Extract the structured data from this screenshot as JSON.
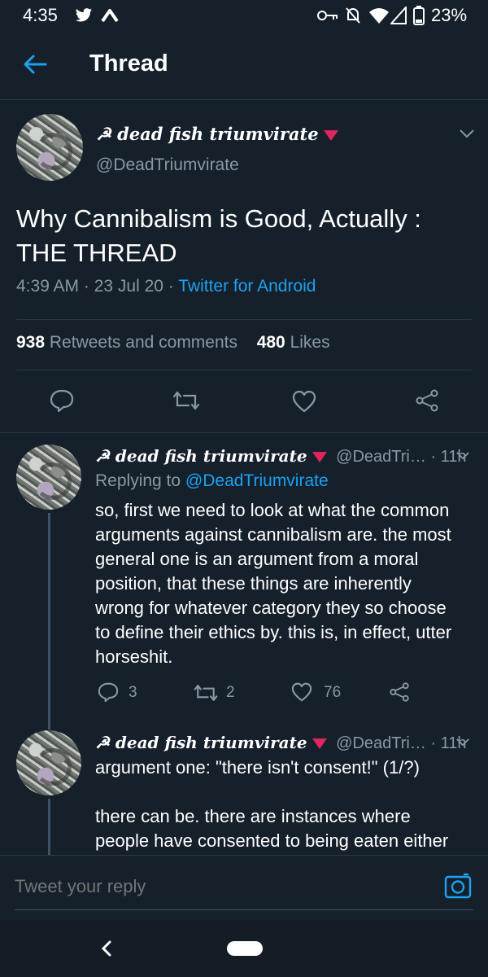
{
  "status_bar": {
    "time": "4:35",
    "battery": "23%",
    "icons": [
      "twitter-icon",
      "notification-icon",
      "key-icon",
      "do-not-disturb-icon",
      "wifi-icon",
      "signal-icon",
      "battery-icon"
    ]
  },
  "app_bar": {
    "title": "Thread",
    "back_icon": "arrow-left-icon"
  },
  "main_tweet": {
    "display_name": "☭ dead fish triumvirate",
    "handle": "@DeadTriumvirate",
    "text_line1": "Why Cannibalism is Good, Actually :",
    "text_line2": "THE THREAD",
    "time": "4:39 AM · 23 Jul 20 · ",
    "source": "Twitter for Android",
    "retweets_count": "938",
    "retweets_label": "Retweets and comments",
    "likes_count": "480",
    "likes_label": "Likes",
    "action_icons": [
      "reply-icon",
      "retweet-icon",
      "like-icon",
      "share-icon"
    ]
  },
  "replies": [
    {
      "display_name": "☭ dead fish triumvirate",
      "handle": "@DeadTri…",
      "time": "· 11h",
      "replying_prefix": "Replying to ",
      "replying_to": "@DeadTriumvirate",
      "lines": [
        "so, first we need to look at what the common",
        "arguments against cannibalism are. the most",
        "general one is an argument from a moral",
        "position, that these things are inherently",
        "wrong for whatever category they so choose",
        "to define their ethics by. this is, in effect, utter",
        "horseshit."
      ],
      "reply_count": "3",
      "retweet_count": "2",
      "like_count": "76"
    },
    {
      "display_name": "☭ dead fish triumvirate",
      "handle": "@DeadTri…",
      "time": "· 11h",
      "lines": [
        "argument one: \"there isn't consent!\" (1/?)",
        "",
        "there can be. there are instances where",
        "people have consented to being eaten either"
      ]
    }
  ],
  "reply_bar": {
    "placeholder": "Tweet your reply",
    "camera_icon": "camera-icon"
  },
  "nav_bar": {
    "back_icon": "chevron-left-icon",
    "home_icon": "home-pill-icon"
  },
  "colors": {
    "background": "#15202b",
    "accent": "#1da1f2",
    "muted": "#8899a6",
    "verified_triangle": "#e0245e"
  }
}
